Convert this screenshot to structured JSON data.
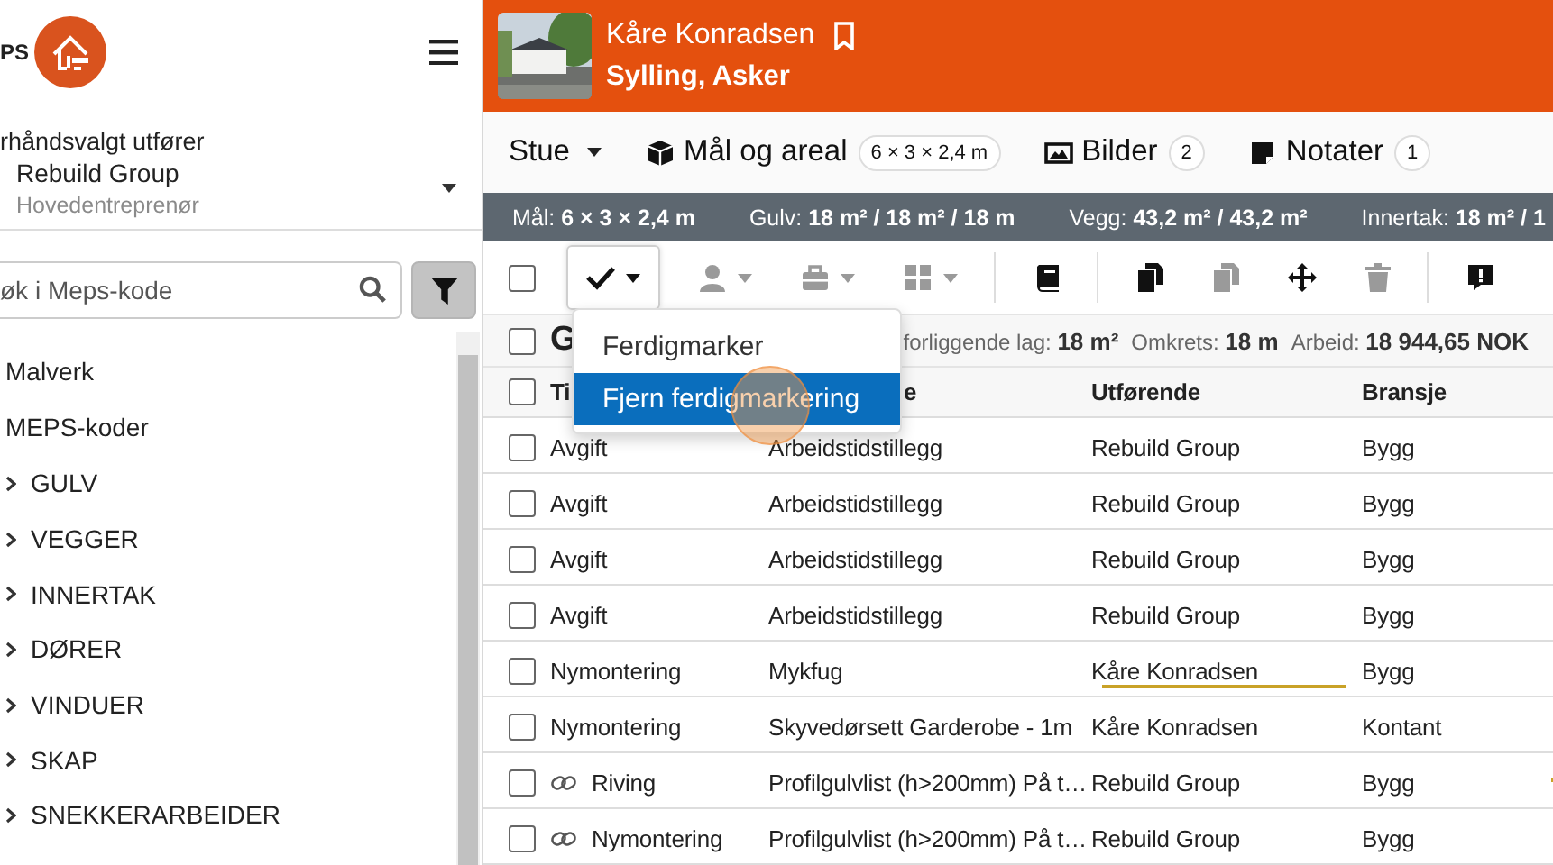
{
  "sidebar": {
    "logo_text": "PS",
    "preset_label": "rhåndsvalgt utfører",
    "executor": {
      "name": "Rebuild Group",
      "role": "Hovedentreprenør"
    },
    "search": {
      "placeholder": "øk i Meps-kode"
    },
    "tree": [
      {
        "label": "Malverk"
      },
      {
        "label": "MEPS-koder",
        "children": [
          {
            "label": "GULV",
            "expanded": false
          },
          {
            "label": "VEGGER",
            "expanded": false
          },
          {
            "label": "INNERTAK",
            "expanded": false
          },
          {
            "label": "DØRER",
            "expanded": false
          },
          {
            "label": "VINDUER",
            "expanded": false
          },
          {
            "label": "SKAP",
            "expanded": false
          },
          {
            "label": "SNEKKERARBEIDER",
            "expanded": false
          }
        ]
      }
    ]
  },
  "header": {
    "name": "Kåre Konradsen",
    "address": "Sylling, Asker"
  },
  "tabs": [
    {
      "kind": "dropdown",
      "label": "Stue"
    },
    {
      "kind": "pill",
      "label": "Mål og areal",
      "badge": "6 × 3 × 2,4 m"
    },
    {
      "kind": "pill",
      "label": "Bilder",
      "badge": "2"
    },
    {
      "kind": "pill",
      "label": "Notater",
      "badge": "1"
    }
  ],
  "info_bar": [
    "Mål: **6 × 3 × 2,4 m**",
    "Gulv: **18 m² / 18 m² / 18 m**",
    "Vegg: **43,2 m² / 43,2 m²**",
    "Innertak: **18 m² / 1**"
  ],
  "toolbar": [
    {
      "kind": "checkbox",
      "checked": false
    },
    {
      "kind": "dropdown",
      "disabled": false,
      "open": true
    },
    {
      "kind": "dropdown",
      "disabled": true,
      "open": false
    },
    {
      "kind": "dropdown",
      "disabled": true,
      "open": false
    },
    {
      "kind": "dropdown",
      "disabled": true,
      "open": false
    },
    {
      "kind": "separator"
    },
    {
      "kind": "button",
      "disabled": false
    },
    {
      "kind": "separator"
    },
    {
      "kind": "button",
      "disabled": false
    },
    {
      "kind": "button",
      "disabled": true
    },
    {
      "kind": "button",
      "disabled": false
    },
    {
      "kind": "button",
      "disabled": true
    },
    {
      "kind": "separator"
    },
    {
      "kind": "button",
      "disabled": false
    }
  ],
  "dropdown_menu": [
    {
      "label": "Ferdigmarker",
      "selected": false
    },
    {
      "label": "Fjern ferdigmarkering",
      "selected": true
    }
  ],
  "group": {
    "title": "G",
    "checked": false,
    "stats": [
      "forliggende lag: **18 m²**",
      "Omkrets: **18 m**",
      "Arbeid: **18 944,65 NOK**"
    ]
  },
  "table": {
    "header_checked": false,
    "columns": [
      "Ti",
      "e",
      "Utførende",
      "Bransje"
    ],
    "rows": [
      {
        "checked": false,
        "linked": false,
        "cells": [
          "Avgift",
          "Arbeidstidstillegg",
          "Rebuild Group",
          "Bygg"
        ],
        "executor_flag": false,
        "end_flag": false
      },
      {
        "checked": false,
        "linked": false,
        "cells": [
          "Avgift",
          "Arbeidstidstillegg",
          "Rebuild Group",
          "Bygg"
        ],
        "executor_flag": false,
        "end_flag": false
      },
      {
        "checked": false,
        "linked": false,
        "cells": [
          "Avgift",
          "Arbeidstidstillegg",
          "Rebuild Group",
          "Bygg"
        ],
        "executor_flag": false,
        "end_flag": false
      },
      {
        "checked": false,
        "linked": false,
        "cells": [
          "Avgift",
          "Arbeidstidstillegg",
          "Rebuild Group",
          "Bygg"
        ],
        "executor_flag": false,
        "end_flag": false
      },
      {
        "checked": false,
        "linked": false,
        "cells": [
          "Nymontering",
          "Mykfug",
          "Kåre Konradsen",
          "Bygg"
        ],
        "executor_flag": true,
        "end_flag": false
      },
      {
        "checked": false,
        "linked": false,
        "cells": [
          "Nymontering",
          "Skyvedørsett Garderobe - 1m",
          "Kåre Konradsen",
          "Kontant"
        ],
        "executor_flag": false,
        "end_flag": false
      },
      {
        "checked": false,
        "linked": true,
        "cells": [
          "Riving",
          "Profilgulvlist (h>200mm) På t…",
          "Rebuild Group",
          "Bygg"
        ],
        "executor_flag": false,
        "end_flag": true
      },
      {
        "checked": false,
        "linked": true,
        "cells": [
          "Nymontering",
          "Profilgulvlist (h>200mm) På t…",
          "Rebuild Group",
          "Bygg"
        ],
        "executor_flag": false,
        "end_flag": false
      }
    ]
  }
}
